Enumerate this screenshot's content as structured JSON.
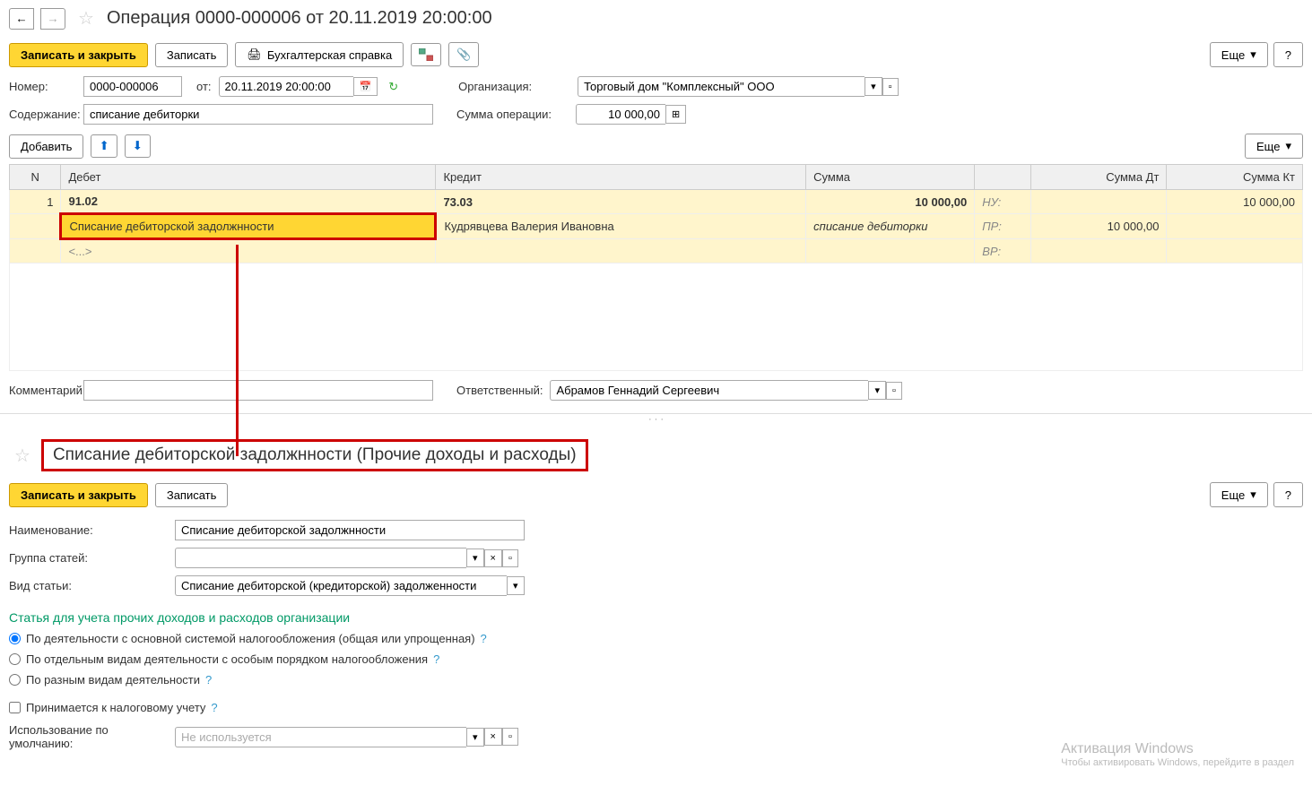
{
  "header": {
    "title": "Операция 0000-000006 от 20.11.2019 20:00:00"
  },
  "toolbar1": {
    "save_close": "Записать и закрыть",
    "save": "Записать",
    "print_ref": "Бухгалтерская справка",
    "more": "Еще",
    "help": "?"
  },
  "form1": {
    "number_label": "Номер:",
    "number_value": "0000-000006",
    "from_label": "от:",
    "date_value": "20.11.2019 20:00:00",
    "org_label": "Организация:",
    "org_value": "Торговый дом \"Комплексный\" ООО",
    "content_label": "Содержание:",
    "content_value": "списание дебиторки",
    "sum_label": "Сумма операции:",
    "sum_value": "10 000,00",
    "add_btn": "Добавить",
    "more": "Еще"
  },
  "table": {
    "col_n": "N",
    "col_debit": "Дебет",
    "col_credit": "Кредит",
    "col_sum": "Сумма",
    "col_sum_dt": "Сумма Дт",
    "col_sum_kt": "Сумма Кт",
    "row": {
      "n": "1",
      "debit_acc": "91.02",
      "debit_sub1": "Списание дебиторской задолжнности",
      "debit_sub2": "<...>",
      "credit_acc": "73.03",
      "credit_sub1": "Кудрявцева Валерия Ивановна",
      "sum": "10 000,00",
      "sum_desc": "списание дебиторки",
      "nu": "НУ:",
      "pr": "ПР:",
      "vr": "ВР:",
      "sum_dt_pr": "10 000,00",
      "sum_kt_nu": "10 000,00"
    }
  },
  "form1_bottom": {
    "comment_label": "Комментарий:",
    "comment_value": "",
    "responsible_label": "Ответственный:",
    "responsible_value": "Абрамов Геннадий Сергеевич"
  },
  "section2": {
    "title": "Списание дебиторской задолжнности (Прочие доходы и расходы)",
    "save_close": "Записать и закрыть",
    "save": "Записать",
    "more": "Еще",
    "help": "?",
    "name_label": "Наименование:",
    "name_value": "Списание дебиторской задолжнности",
    "group_label": "Группа статей:",
    "group_value": "",
    "type_label": "Вид статьи:",
    "type_value": "Списание дебиторской (кредиторской) задолженности",
    "green_heading": "Статья для учета прочих доходов и расходов организации",
    "radio1": "По деятельности с основной системой налогообложения (общая или упрощенная)",
    "radio2": "По отдельным видам деятельности с особым порядком налогообложения",
    "radio3": "По разным видам деятельности",
    "check1": "Принимается к налоговому учету",
    "usage_label": "Использование по умолчанию:",
    "usage_placeholder": "Не используется"
  },
  "watermark": {
    "title": "Активация Windows",
    "sub": "Чтобы активировать Windows, перейдите в раздел"
  }
}
